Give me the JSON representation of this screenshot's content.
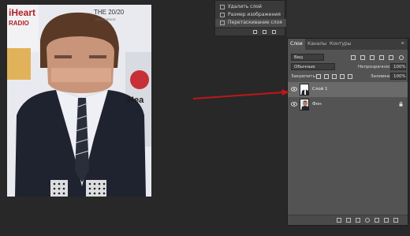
{
  "history": {
    "items": [
      {
        "label": "Удалить слой",
        "selected": false
      },
      {
        "label": "Размер изображения",
        "selected": false
      },
      {
        "label": "Перетаскивание слоя",
        "selected": true
      }
    ]
  },
  "photo": {
    "backdrop_texts": [
      "iHeart",
      "RADIO",
      "THE 20/20",
      "EXPERIENCE",
      "iHea"
    ],
    "description_icon": "photo-composite"
  },
  "layers_panel": {
    "tabs": [
      "Слои",
      "Каналы",
      "Контуры"
    ],
    "active_tab": "Слои",
    "filter_label": "Вид",
    "blend_mode": "Обычные",
    "opacity_label": "Непрозрачность:",
    "opacity_value": "100%",
    "lock_label": "Закрепить:",
    "fill_label": "Заливка:",
    "fill_value": "100%",
    "layers": [
      {
        "name": "Слой 1",
        "selected": true,
        "locked": false
      },
      {
        "name": "Фон",
        "selected": false,
        "locked": true
      }
    ]
  },
  "colors": {
    "arrow": "#c0161b",
    "panel_bg": "#535353",
    "selected_layer": "#6a6a6a"
  }
}
